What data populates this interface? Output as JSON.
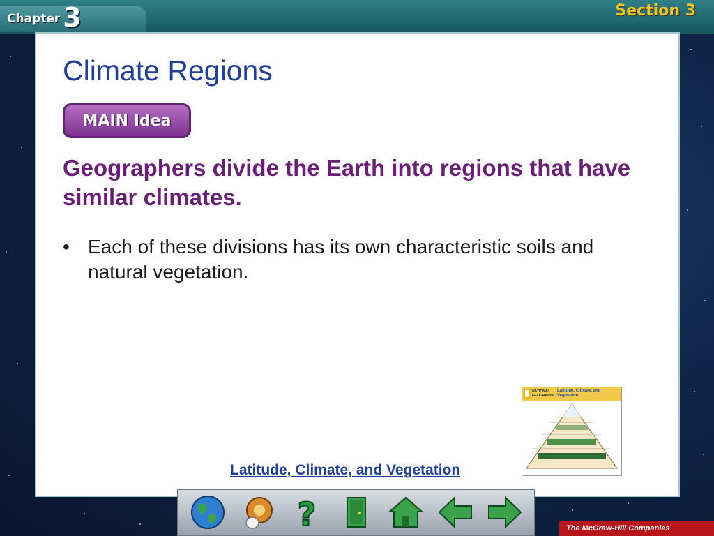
{
  "header": {
    "chapter_word": "Chapter",
    "chapter_number": "3",
    "section_label": "Section 3"
  },
  "slide": {
    "title": "Climate Regions",
    "badge": "MAIN Idea",
    "main_idea": "Geographers divide the Earth into regions that have similar climates.",
    "bullets": [
      "Each of these divisions has its own characteristic soils and natural vegetation."
    ],
    "link": "Latitude, Climate, and Vegetation"
  },
  "thumbnail": {
    "brand": "NATIONAL GEOGRAPHIC",
    "title": "Latitude, Climate, and Vegetation"
  },
  "nav": {
    "buttons": [
      "globe-icon",
      "reference-icon",
      "help-icon",
      "exit-icon",
      "home-icon",
      "back-arrow-icon",
      "forward-arrow-icon"
    ]
  },
  "footer": {
    "publisher": "The McGraw-Hill Companies"
  },
  "colors": {
    "title": "#1f3f9a",
    "main_idea": "#6b1e78",
    "section": "#f0c52a",
    "header": "#17565f"
  }
}
